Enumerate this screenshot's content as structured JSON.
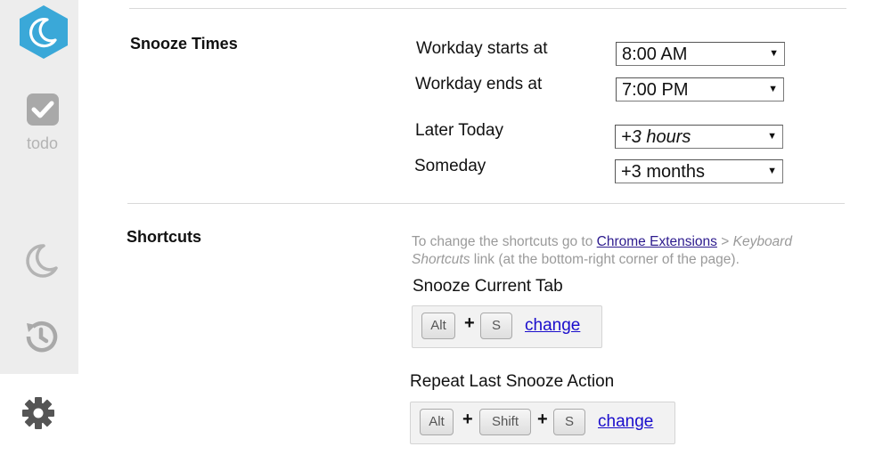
{
  "sidebar": {
    "todo_label": "todo",
    "accent_color": "#3ba9d9"
  },
  "snooze_times": {
    "title": "Snooze Times",
    "rows": [
      {
        "label": "Workday starts at",
        "value": "8:00 AM"
      },
      {
        "label": "Workday ends at",
        "value": "7:00 PM"
      },
      {
        "label": "Later Today",
        "value": "+3 hours"
      },
      {
        "label": "Someday",
        "value": "+3 months"
      }
    ]
  },
  "shortcuts": {
    "title": "Shortcuts",
    "help_prefix": "To change the shortcuts go to ",
    "help_link": "Chrome Extensions",
    "help_sep": " > ",
    "help_italic": "Keyboard Shortcuts",
    "help_suffix": " link (at the bottom-right corner of the page).",
    "items": [
      {
        "name": "Snooze Current Tab",
        "keys": [
          "Alt",
          "S"
        ],
        "change_label": "change"
      },
      {
        "name": "Repeat Last Snooze Action",
        "keys": [
          "Alt",
          "Shift",
          "S"
        ],
        "change_label": "change"
      }
    ]
  }
}
